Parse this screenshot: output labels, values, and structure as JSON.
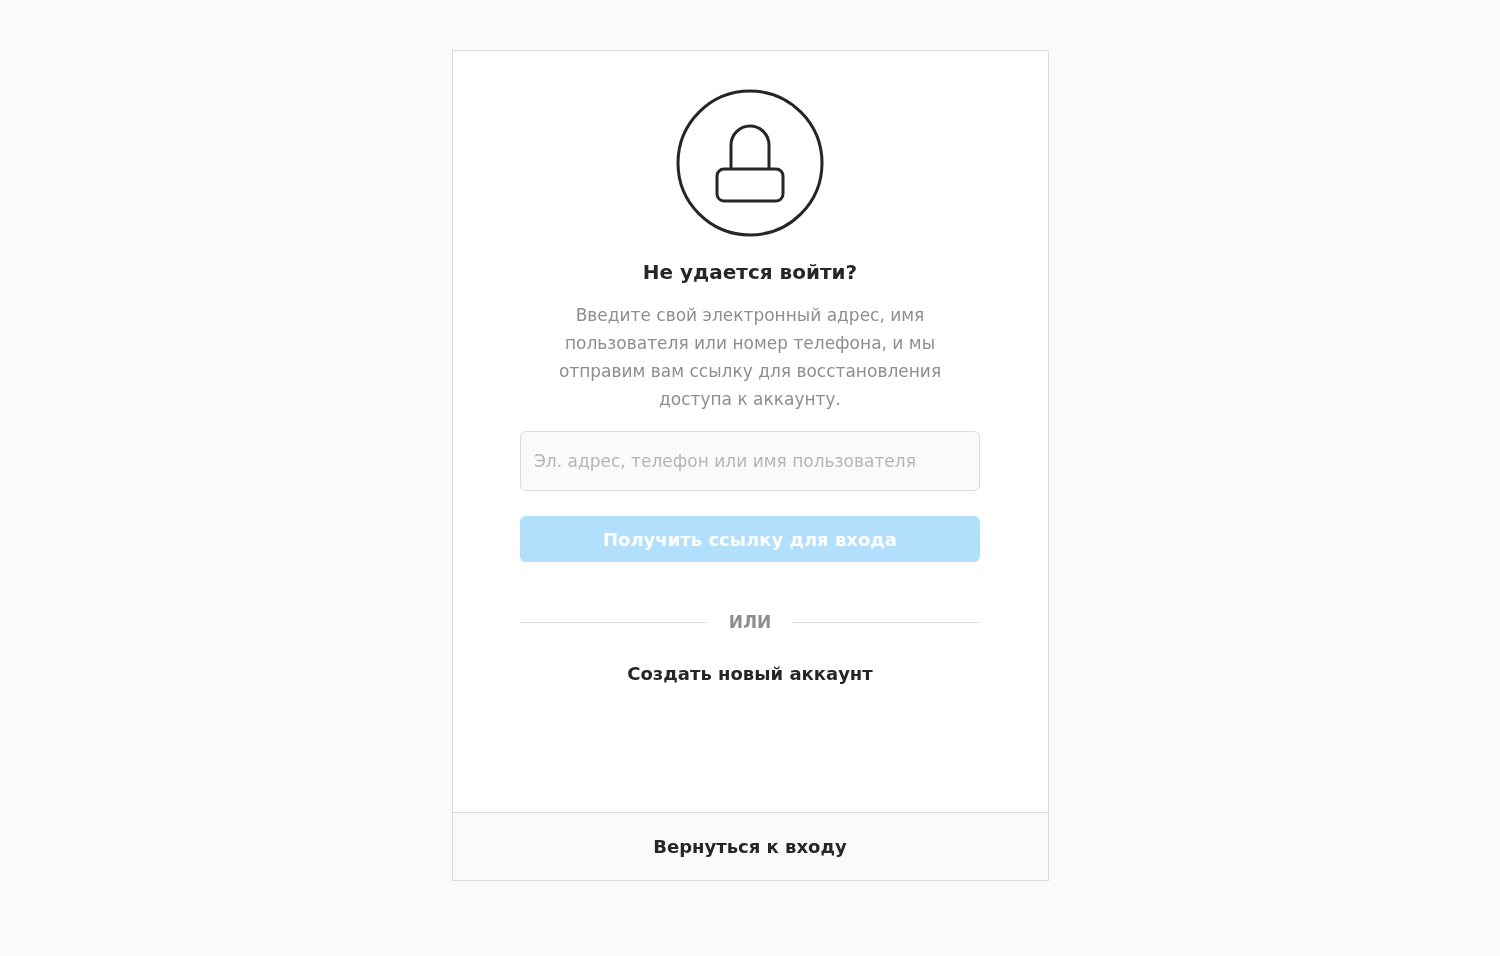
{
  "title": "Не удается войти?",
  "description": "Введите свой электронный адрес, имя пользователя или номер телефона, и мы отправим вам ссылку для восстановления доступа к аккаунту.",
  "field": {
    "placeholder": "Эл. адрес, телефон или имя пользователя"
  },
  "submit": {
    "label": "Получить ссылку для входа",
    "disabled": true
  },
  "divider": "ИЛИ",
  "create_link": "Создать новый аккаунт",
  "footer": {
    "label": "Вернуться к входу"
  }
}
